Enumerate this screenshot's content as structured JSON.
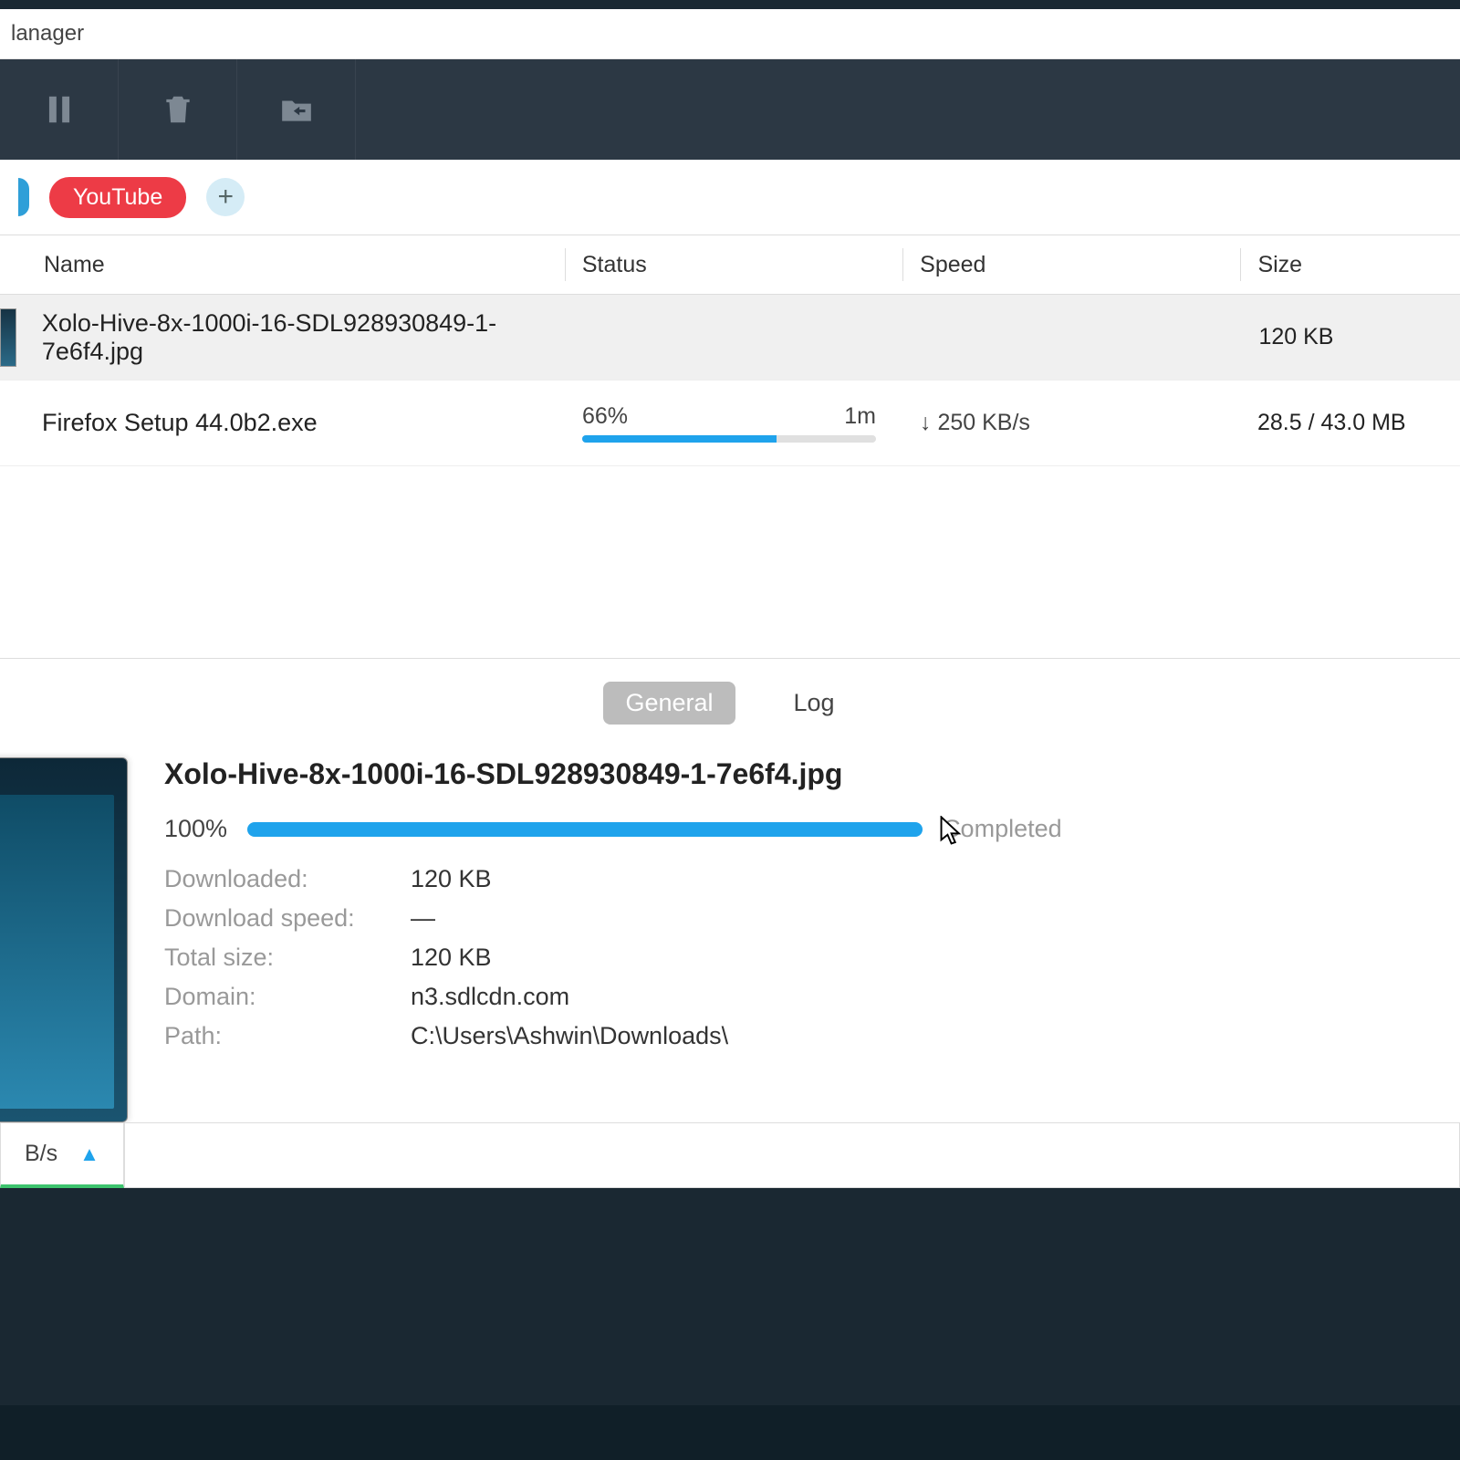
{
  "titlebar": {
    "title": "lanager"
  },
  "chips": {
    "youtube": "YouTube",
    "add": "+"
  },
  "columns": {
    "name": "Name",
    "status": "Status",
    "speed": "Speed",
    "size": "Size"
  },
  "rows": [
    {
      "name": "Xolo-Hive-8x-1000i-16-SDL928930849-1-7e6f4.jpg",
      "size": "120 KB",
      "percent": "",
      "eta": "",
      "speed": ""
    },
    {
      "name": "Firefox Setup 44.0b2.exe",
      "percent": "66%",
      "percent_num": 66,
      "eta": "1m",
      "speed": "↓ 250 KB/s",
      "size": "28.5 / 43.0 MB"
    }
  ],
  "details": {
    "tabs": {
      "general": "General",
      "log": "Log"
    },
    "filename": "Xolo-Hive-8x-1000i-16-SDL928930849-1-7e6f4.jpg",
    "percent": "100%",
    "status": "Completed",
    "labels": {
      "downloaded": "Downloaded:",
      "speed": "Download speed:",
      "total": "Total size:",
      "domain": "Domain:",
      "path": "Path:"
    },
    "values": {
      "downloaded": "120 KB",
      "speed": "—",
      "total": "120 KB",
      "domain": "n3.sdlcdn.com",
      "path": "C:\\Users\\Ashwin\\Downloads\\"
    }
  },
  "footer": {
    "speed_unit": "B/s"
  }
}
